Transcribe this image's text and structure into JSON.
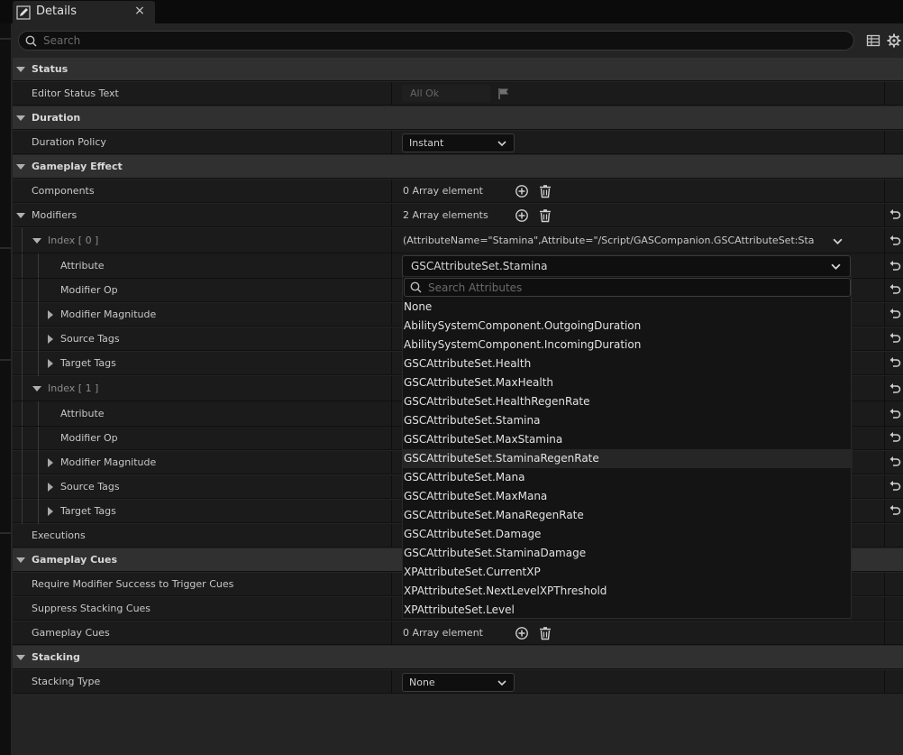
{
  "tab": {
    "title": "Details",
    "close": "×"
  },
  "search": {
    "placeholder": "Search"
  },
  "rows": {
    "status": "Status",
    "editor_status_text": "Editor Status Text",
    "editor_status_value": "All Ok",
    "duration": "Duration",
    "duration_policy": "Duration Policy",
    "duration_policy_value": "Instant",
    "gameplay_effect": "Gameplay Effect",
    "components": "Components",
    "components_value": "0 Array element",
    "modifiers": "Modifiers",
    "modifiers_value": "2 Array elements",
    "index0": "Index [ 0 ]",
    "index0_value": "(AttributeName=\"Stamina\",Attribute=\"/Script/GASCompanion.GSCAttributeSet:Stamina\",AttributeOwner=\"/Script/GASCompanion.GSCAttributeSet\")",
    "attribute": "Attribute",
    "attribute_value": "GSCAttributeSet.Stamina",
    "modifier_op": "Modifier Op",
    "modifier_magnitude": "Modifier Magnitude",
    "source_tags": "Source Tags",
    "target_tags": "Target Tags",
    "index1": "Index [ 1 ]",
    "executions": "Executions",
    "gameplay_cues_cat": "Gameplay Cues",
    "require_modifier_success": "Require Modifier Success to Trigger Cues",
    "suppress_stacking_cues": "Suppress Stacking Cues",
    "gameplay_cues": "Gameplay Cues",
    "gameplay_cues_value": "0 Array element",
    "stacking": "Stacking",
    "stacking_type": "Stacking Type",
    "stacking_type_value": "None"
  },
  "dropdown": {
    "search_placeholder": "Search Attributes",
    "items": [
      "None",
      "AbilitySystemComponent.OutgoingDuration",
      "AbilitySystemComponent.IncomingDuration",
      "GSCAttributeSet.Health",
      "GSCAttributeSet.MaxHealth",
      "GSCAttributeSet.HealthRegenRate",
      "GSCAttributeSet.Stamina",
      "GSCAttributeSet.MaxStamina",
      "GSCAttributeSet.StaminaRegenRate",
      "GSCAttributeSet.Mana",
      "GSCAttributeSet.MaxMana",
      "GSCAttributeSet.ManaRegenRate",
      "GSCAttributeSet.Damage",
      "GSCAttributeSet.StaminaDamage",
      "XPAttributeSet.CurrentXP",
      "XPAttributeSet.NextLevelXPThreshold",
      "XPAttributeSet.Level"
    ],
    "hover_index": 8
  },
  "icons": {
    "tab": "pencil-icon",
    "search": "search-icon",
    "table_view": "table-icon",
    "settings": "gear-icon",
    "add": "add-element-icon",
    "delete": "trash-icon",
    "reset": "reset-to-default-icon",
    "flag": "flag-icon",
    "dropdown": "chevron-down-icon"
  }
}
